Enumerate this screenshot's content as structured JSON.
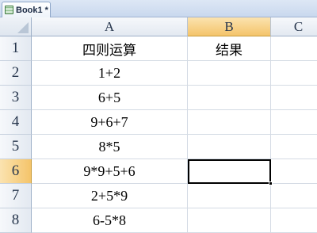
{
  "workbook": {
    "tab_label": "Book1 *"
  },
  "columns": [
    "A",
    "B",
    "C"
  ],
  "active_column": "B",
  "active_row": "6",
  "rows": [
    {
      "num": "1",
      "a": "四则运算",
      "b": "结果"
    },
    {
      "num": "2",
      "a": "1+2",
      "b": ""
    },
    {
      "num": "3",
      "a": "6+5",
      "b": ""
    },
    {
      "num": "4",
      "a": "9+6+7",
      "b": ""
    },
    {
      "num": "5",
      "a": "8*5",
      "b": ""
    },
    {
      "num": "6",
      "a": "9*9+5+6",
      "b": ""
    },
    {
      "num": "7",
      "a": "2+5*9",
      "b": ""
    },
    {
      "num": "8",
      "a": "6-5*8",
      "b": ""
    }
  ]
}
